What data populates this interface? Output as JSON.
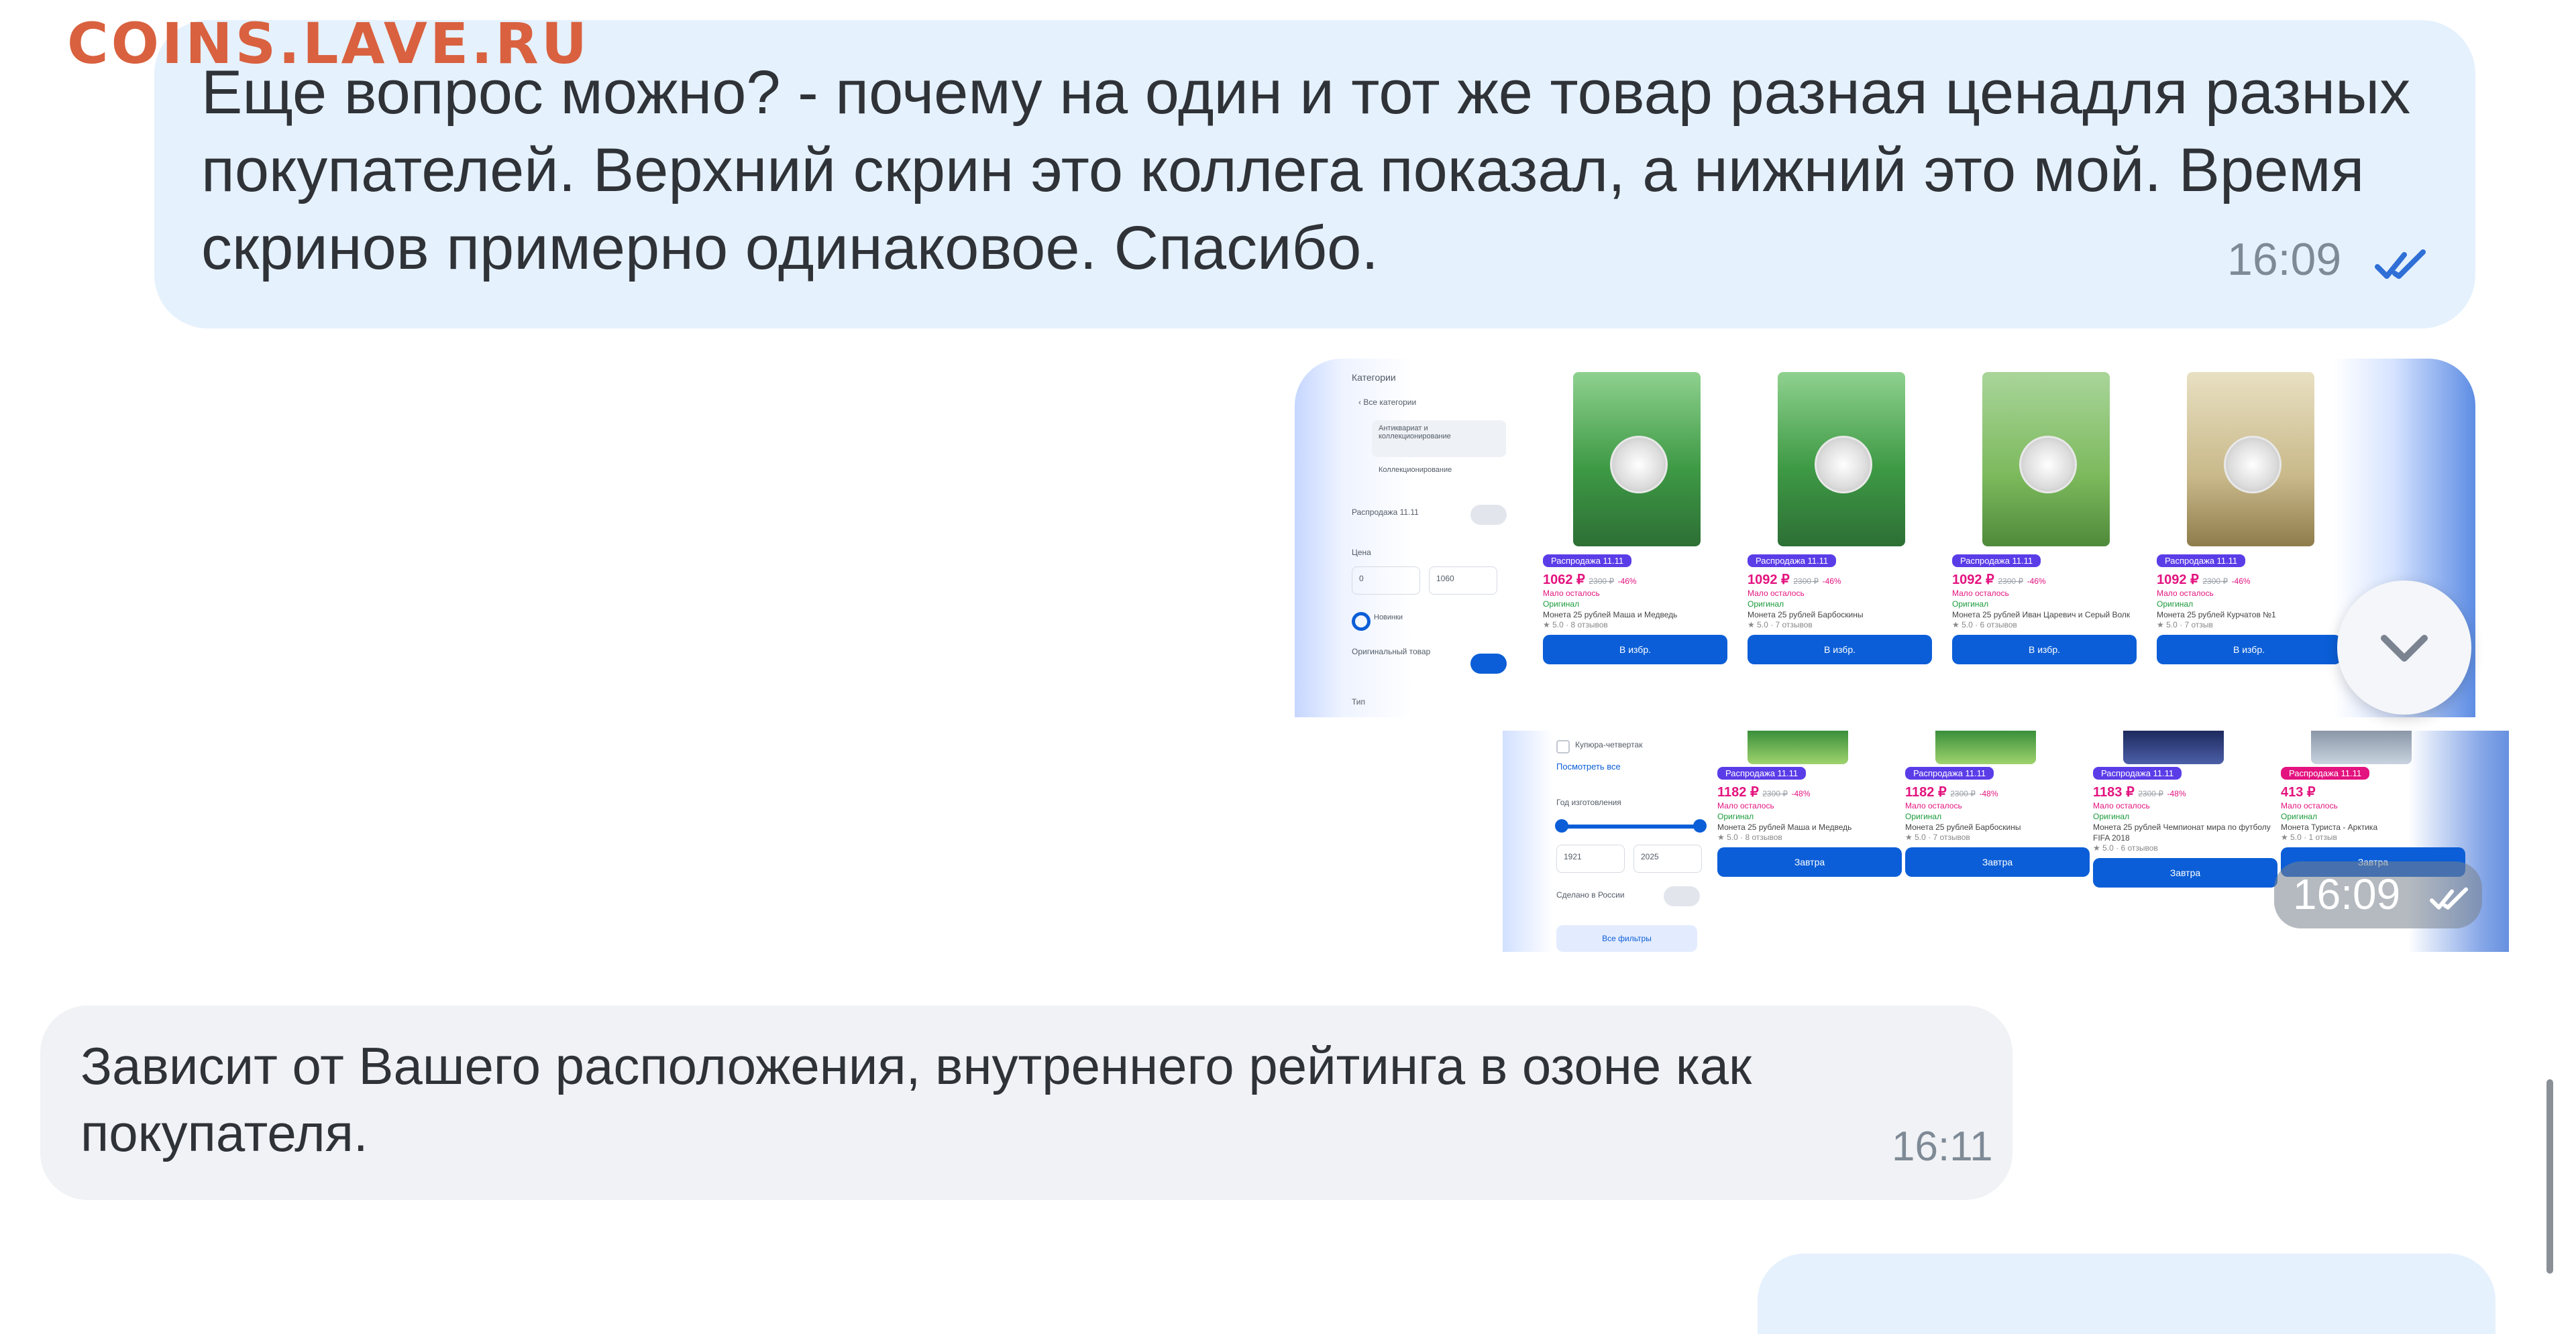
{
  "watermark": "COINS.LAVE.RU",
  "messages": [
    {
      "direction": "outgoing",
      "text": "Еще вопрос можно? - почему на один и тот же товар разная ценадля разных покупателей. Верхний скрин это коллега показал, а нижний это мой. Время скринов примерно одинаковое. Спасибо.",
      "time": "16:09",
      "status_icon": "double-check-icon"
    },
    {
      "direction": "outgoing",
      "type": "image-attachment",
      "time": "16:09",
      "status_icon": "double-check-icon",
      "shot_top": {
        "sidebar": [
          "Категории",
          "‹ Все категории",
          "Антиквариат и коллекционирование",
          "Коллекционирование",
          "Распродажа 11.11",
          "Цена",
          "0",
          "1060",
          "Новинки",
          "Оригинальный товар",
          "Тип"
        ],
        "cards": [
          {
            "badge": "Распродажа 11.11",
            "price": "1062 ₽",
            "old": "2300 ₽",
            "disc": "-46%",
            "stock": "Мало осталось",
            "orig": "Оригинал",
            "title": "Монета 25 рублей Маша и Медведь",
            "rating": "★ 5.0 · 8 отзывов",
            "button": "В избр."
          },
          {
            "badge": "Распродажа 11.11",
            "price": "1092 ₽",
            "old": "2300 ₽",
            "disc": "-46%",
            "stock": "Мало осталось",
            "orig": "Оригинал",
            "title": "Монета 25 рублей Барбоскины",
            "rating": "★ 5.0 · 7 отзывов",
            "button": "В избр."
          },
          {
            "badge": "Распродажа 11.11",
            "price": "1092 ₽",
            "old": "2300 ₽",
            "disc": "-46%",
            "stock": "Мало осталось",
            "orig": "Оригинал",
            "title": "Монета 25 рублей Иван Царевич и Серый Волк",
            "rating": "★ 5.0 · 6 отзывов",
            "button": "В избр."
          },
          {
            "badge": "Распродажа 11.11",
            "price": "1092 ₽",
            "old": "2300 ₽",
            "disc": "-46%",
            "stock": "Мало осталось",
            "orig": "Оригинал",
            "title": "Монета 25 рублей Курчатов №1",
            "rating": "★ 5.0 · 7 отзыв",
            "button": "В избр."
          }
        ]
      },
      "shot_bottom": {
        "sidebar": [
          "Купюра-четвертак",
          "Посмотреть все",
          "Год изготовления",
          "1921",
          "2025",
          "Сделано в России",
          "Все фильтры"
        ],
        "cards": [
          {
            "badge": "Распродажа 11.11",
            "price": "1182 ₽",
            "old": "2300 ₽",
            "disc": "-48%",
            "stock": "Мало осталось",
            "orig": "Оригинал",
            "title": "Монета 25 рублей Маша и Медведь",
            "rating": "★ 5.0 · 8 отзывов",
            "button": "Завтра"
          },
          {
            "badge": "Распродажа 11.11",
            "price": "1182 ₽",
            "old": "2300 ₽",
            "disc": "-48%",
            "stock": "Мало осталось",
            "orig": "Оригинал",
            "title": "Монета 25 рублей Барбоскины",
            "rating": "★ 5.0 · 7 отзывов",
            "button": "Завтра"
          },
          {
            "badge": "Распродажа 11.11",
            "price": "1183 ₽",
            "old": "2300 ₽",
            "disc": "-48%",
            "stock": "Мало осталось",
            "orig": "Оригинал",
            "title": "Монета 25 рублей Чемпионат мира по футболу FIFA 2018",
            "rating": "★ 5.0 · 6 отзывов",
            "button": "Завтра"
          },
          {
            "badge": "Распродажа 11.11",
            "price": "413 ₽",
            "old": "",
            "disc": "",
            "stock": "Мало осталось",
            "orig": "Оригинал",
            "title": "Монета Туриста - Арктика",
            "rating": "★ 5.0 · 1 отзыв",
            "button": "Завтра"
          }
        ]
      }
    },
    {
      "direction": "incoming",
      "text": "Зависит от Вашего расположения, внутреннего рейтинга в озоне как покупателя.",
      "time": "16:11"
    }
  ],
  "colors": {
    "outgoing_bubble": "#e5f1fd",
    "incoming_bubble": "#f0f2f5",
    "check": "#2f6fd6",
    "watermark": "#d9613f",
    "accent_blue": "#0b5ed7",
    "price_pink": "#e3137f"
  }
}
